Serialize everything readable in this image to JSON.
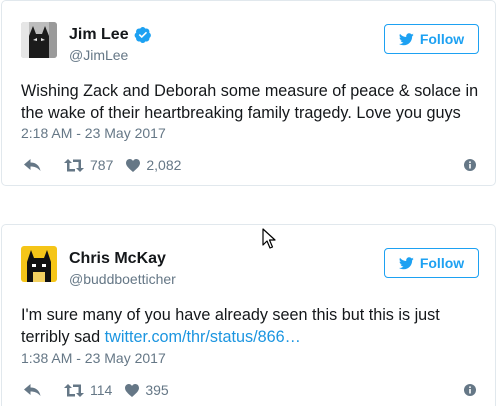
{
  "tweets": [
    {
      "name": "Jim Lee",
      "handle": "@JimLee",
      "verified": true,
      "follow_label": "Follow",
      "text": "Wishing Zack and Deborah some measure of peace & solace in the wake of their heartbreaking family tragedy. Love you guys",
      "link": "",
      "timestamp": "2:18 AM - 23 May 2017",
      "retweets": "787",
      "likes": "2,082"
    },
    {
      "name": "Chris McKay",
      "handle": "@buddboetticher",
      "verified": false,
      "follow_label": "Follow",
      "text": "I'm sure many of you have already seen this but this is just terribly sad ",
      "link": "twitter.com/thr/status/866…",
      "timestamp": "1:38 AM - 23 May 2017",
      "retweets": "114",
      "likes": "395"
    }
  ],
  "colors": {
    "accent": "#1da1f2",
    "link": "#1b95e0",
    "muted": "#657786",
    "border": "#e1e8ed"
  },
  "icons": [
    "bird-icon",
    "verified-icon",
    "reply-icon",
    "retweet-icon",
    "heart-icon",
    "info-icon",
    "mouse-cursor-icon"
  ]
}
